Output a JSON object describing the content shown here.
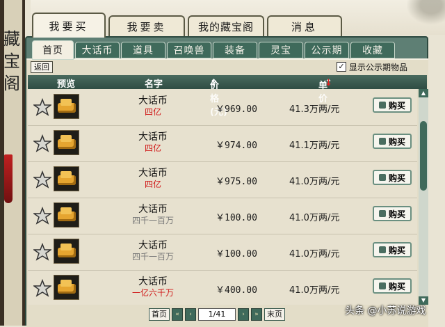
{
  "side_title": [
    "藏",
    "宝",
    "阁"
  ],
  "top_tabs": [
    {
      "label": "我要买",
      "active": true
    },
    {
      "label": "我要卖",
      "active": false
    },
    {
      "label": "我的藏宝阁",
      "active": false
    },
    {
      "label": "消息",
      "active": false
    }
  ],
  "sub_tabs": [
    {
      "label": "首页",
      "active": true
    },
    {
      "label": "大话币",
      "active": false
    },
    {
      "label": "道具",
      "active": false
    },
    {
      "label": "召唤兽",
      "active": false
    },
    {
      "label": "装备",
      "active": false
    },
    {
      "label": "灵宝",
      "active": false
    },
    {
      "label": "公示期",
      "active": false
    },
    {
      "label": "收藏",
      "active": false
    }
  ],
  "toolbar": {
    "back_label": "返回",
    "show_public_label": "显示公示期物品",
    "show_public_checked": true
  },
  "table": {
    "headers": {
      "preview": "预览",
      "name": "名字",
      "price": "价格(元)",
      "unit": "单价"
    },
    "rows": [
      {
        "name": "大话币",
        "sub": "四亿",
        "sub_color": "red",
        "price": "￥969.00",
        "unit": "41.3万两/元",
        "buy": "购买"
      },
      {
        "name": "大话币",
        "sub": "四亿",
        "sub_color": "red",
        "price": "￥974.00",
        "unit": "41.1万两/元",
        "buy": "购买"
      },
      {
        "name": "大话币",
        "sub": "四亿",
        "sub_color": "red",
        "price": "￥975.00",
        "unit": "41.0万两/元",
        "buy": "购买"
      },
      {
        "name": "大话币",
        "sub": "四千一百万",
        "sub_color": "grey",
        "price": "￥100.00",
        "unit": "41.0万两/元",
        "buy": "购买"
      },
      {
        "name": "大话币",
        "sub": "四千一百万",
        "sub_color": "grey",
        "price": "￥100.00",
        "unit": "41.0万两/元",
        "buy": "购买"
      },
      {
        "name": "大话币",
        "sub": "一亿六千万",
        "sub_color": "red",
        "price": "￥400.00",
        "unit": "41.0万两/元",
        "buy": "购买"
      }
    ]
  },
  "pager": {
    "first": "首页",
    "last": "末页",
    "page": "1/41"
  },
  "watermark": "头条 @小苏说游戏"
}
